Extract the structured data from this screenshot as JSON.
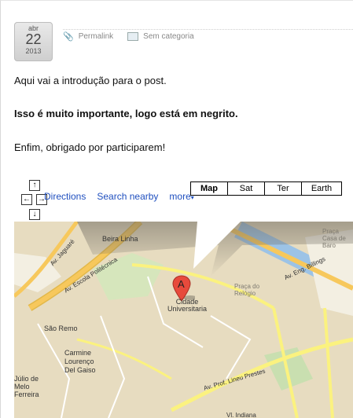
{
  "date": {
    "month": "abr",
    "day": "22",
    "year": "2013"
  },
  "meta": {
    "permalink": "Permalink",
    "category": "Sem categoria"
  },
  "post": {
    "p1": "Aqui vai a introdução para o post.",
    "p2": "Isso é muito importante, logo está em negrito.",
    "p3": "Enfim, obrigado por participarem!"
  },
  "map": {
    "links": [
      "Directions",
      "Search nearby",
      "more"
    ],
    "types": [
      "Map",
      "Sat",
      "Ter",
      "Earth"
    ],
    "active_type": "Map",
    "marker": "A",
    "labels": {
      "beira_linha": "Beira Linha",
      "av_jaguare": "Av. Jaguaré",
      "av_escola": "Av. Escola Politécnica",
      "cidade": "Cidade Universitaria",
      "sao_remo": "São Remo",
      "carmine": "Carmine Lourenço Del Gaiso",
      "julio": "Júlio de Melo Ferreira",
      "praca_relogio": "Praça do Relógio",
      "av_billings": "Av. Eng. Billings",
      "av_lineu": "Av. Prof. Lineu Prestes",
      "praca_casa": "Praça Casa de Baro",
      "vl_indiana": "Vl. Indiana"
    },
    "colors": {
      "land": "#e7dcc0",
      "road": "#fbf27f",
      "road_stroke": "#e2b84a",
      "highway": "#f7c85c",
      "water": "#9cc3e6",
      "park": "#c9dfb0"
    }
  }
}
